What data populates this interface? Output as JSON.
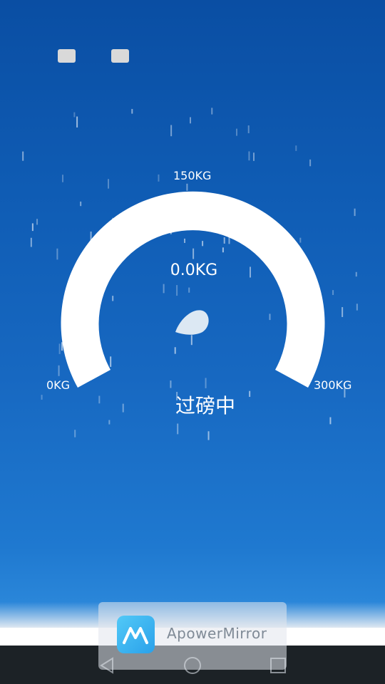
{
  "top_buttons": [
    "",
    ""
  ],
  "gauge": {
    "min_label": "0KG",
    "mid_label": "150KG",
    "max_label": "300KG",
    "min_value": 0,
    "max_value": 300,
    "current_value": 0.0,
    "reading": "0.0KG",
    "status": "过磅中",
    "arc_color": "#ffffff"
  },
  "overlay": {
    "app_name": "ApowerMirror"
  },
  "navigation": {
    "back": "back-icon",
    "home": "home-icon",
    "recent": "recent-apps-icon"
  },
  "colors": {
    "background_top": "#0a4ea3",
    "background_bottom": "#2a86d9",
    "navbar": "#1c2226",
    "logo": "#2aa1ea"
  }
}
